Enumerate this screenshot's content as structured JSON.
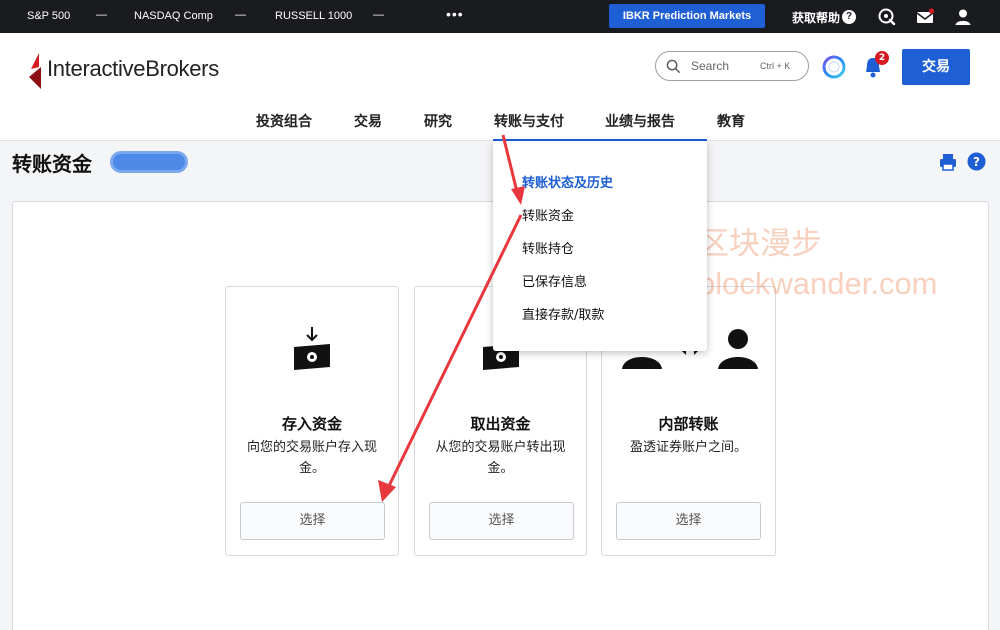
{
  "ticker": {
    "items": [
      "S&P 500",
      "NASDAQ Comp",
      "RUSSELL 1000"
    ],
    "dash": "—",
    "more": "•••",
    "prediction_button": "IBKR Prediction Markets",
    "help_label": "获取帮助",
    "help_q": "?"
  },
  "header": {
    "logo_bold": "Interactive",
    "logo_rest": "Brokers",
    "search_placeholder": "Search",
    "search_shortcut": "Ctrl + K",
    "bell_count": "2",
    "trade_button": "交易",
    "nav": [
      "投资组合",
      "交易",
      "研究",
      "转账与支付",
      "业绩与报告",
      "教育"
    ]
  },
  "dropdown": {
    "items": [
      "转账状态及历史",
      "转账资金",
      "转账持仓",
      "已保存信息",
      "直接存款/取款"
    ]
  },
  "page": {
    "title": "转账资金"
  },
  "cards": [
    {
      "title": "存入资金",
      "desc": "向您的交易账户存入现金。",
      "button": "选择"
    },
    {
      "title": "取出资金",
      "desc": "从您的交易账户转出现金。",
      "button": "选择"
    },
    {
      "title": "内部转账",
      "desc": "盈透证券账户之间。",
      "button": "选择"
    }
  ],
  "watermark": {
    "line1": "区块漫步",
    "line2": "blockwander.com"
  },
  "colors": {
    "brand_blue": "#1f5fd6",
    "ticker_bg": "#1a1b1f",
    "logo_red": "#d71920",
    "arrow_red": "#e8383d"
  }
}
